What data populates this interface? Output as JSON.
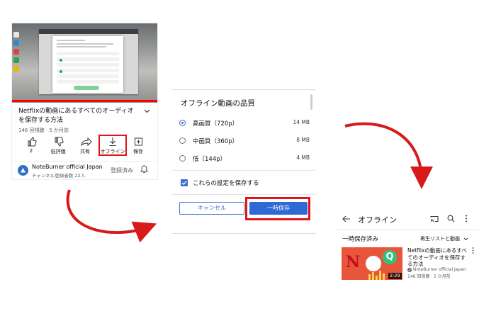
{
  "watch": {
    "title": "Netflixの動画にあるすべてのオーディオを保存する方法",
    "views_meta": "146 回視聴 · 5 か月前",
    "progress": 1.0,
    "actions": [
      {
        "label": "2",
        "icon": "thumbs-up-icon"
      },
      {
        "label": "低評価",
        "icon": "thumbs-down-icon"
      },
      {
        "label": "共有",
        "icon": "share-icon"
      },
      {
        "label": "オフライン",
        "icon": "download-icon"
      },
      {
        "label": "保存",
        "icon": "add-to-playlist-icon"
      }
    ],
    "channel_name": "NoteBurner official Japan",
    "channel_subs": "チャンネル登録者数 22人",
    "subscribed_label": "登録済み"
  },
  "quality_dialog": {
    "title": "オフライン動画の品質",
    "options": [
      {
        "label": "高画質（720p）",
        "size": "14 MB",
        "selected": true
      },
      {
        "label": "中画質（360p）",
        "size": "8 MB",
        "selected": false
      },
      {
        "label": "低（144p）",
        "size": "4 MB",
        "selected": false
      }
    ],
    "remember_label": "これらの設定を保存する",
    "remember_checked": true,
    "cancel_label": "キャンセル",
    "save_label": "一時保存"
  },
  "library": {
    "title": "オフライン",
    "section_label": "一時保存済み",
    "sort_label": "再生リストと動画",
    "video": {
      "title": "Netflixの動画にあるすべてのオーディオを保存する方法",
      "channel": "NoteBurner official Japan",
      "meta": "146 回視聴 · 5 か月前",
      "duration": "2:29"
    }
  },
  "colors": {
    "highlight": "#e3131b",
    "accent_blue": "#2f69d5",
    "arrow_red": "#d81a1a"
  }
}
